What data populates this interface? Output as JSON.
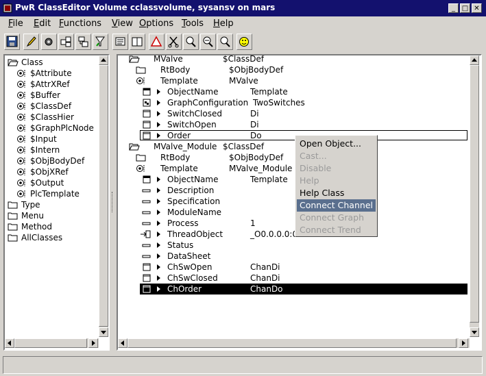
{
  "window": {
    "title": "PwR ClassEditor Volume cclassvolume, sysansv on mars"
  },
  "menubar": [
    {
      "u": "F",
      "rest": "ile"
    },
    {
      "u": "E",
      "rest": "dit"
    },
    {
      "u": "F",
      "rest": "unctions"
    },
    {
      "u": "V",
      "rest": "iew"
    },
    {
      "u": "O",
      "rest": "ptions"
    },
    {
      "u": "T",
      "rest": "ools"
    },
    {
      "u": "H",
      "rest": "elp"
    }
  ],
  "toolbar": [
    "save-icon",
    "edit-icon",
    "gear-icon",
    "objects-icon",
    "hierarchy-icon",
    "filter-icon",
    "view-icon",
    "book-icon",
    "warning-icon",
    "cut-icon",
    "zoom-in-icon",
    "zoom-out-icon",
    "smiley-icon"
  ],
  "left_tree": [
    {
      "label": "Class",
      "indent": 0,
      "icon": "folder-open"
    },
    {
      "label": "$Attribute",
      "indent": 1,
      "icon": "gear"
    },
    {
      "label": "$AttrXRef",
      "indent": 1,
      "icon": "gear"
    },
    {
      "label": "$Buffer",
      "indent": 1,
      "icon": "gear"
    },
    {
      "label": "$ClassDef",
      "indent": 1,
      "icon": "gear"
    },
    {
      "label": "$ClassHier",
      "indent": 1,
      "icon": "gear"
    },
    {
      "label": "$GraphPlcNode",
      "indent": 1,
      "icon": "gear"
    },
    {
      "label": "$Input",
      "indent": 1,
      "icon": "gear"
    },
    {
      "label": "$Intern",
      "indent": 1,
      "icon": "gear"
    },
    {
      "label": "$ObjBodyDef",
      "indent": 1,
      "icon": "gear"
    },
    {
      "label": "$ObjXRef",
      "indent": 1,
      "icon": "gear"
    },
    {
      "label": "$Output",
      "indent": 1,
      "icon": "gear"
    },
    {
      "label": "PlcTemplate",
      "indent": 1,
      "icon": "gear"
    },
    {
      "label": "Type",
      "indent": 0,
      "icon": "folder"
    },
    {
      "label": "Menu",
      "indent": 0,
      "icon": "folder"
    },
    {
      "label": "Method",
      "indent": 0,
      "icon": "folder"
    },
    {
      "label": "AllClasses",
      "indent": 0,
      "icon": "folder"
    }
  ],
  "right_tree": [
    {
      "name": "MValve",
      "cls": "$ClassDef",
      "level": 0,
      "icon": "folder-open"
    },
    {
      "name": "RtBody",
      "cls": "$ObjBodyDef",
      "level": 1,
      "icon": "folder"
    },
    {
      "name": "Template",
      "cls": "MValve",
      "level": 1,
      "icon": "gear"
    },
    {
      "name": "ObjectName",
      "cls": "Template",
      "level": 2,
      "icon": "attr"
    },
    {
      "name": "GraphConfiguration",
      "cls": "TwoSwitches",
      "level": 2,
      "icon": "graph"
    },
    {
      "name": "SwitchClosed",
      "cls": "Di",
      "level": 2,
      "icon": "box"
    },
    {
      "name": "SwitchOpen",
      "cls": "Di",
      "level": 2,
      "icon": "box"
    },
    {
      "name": "Order",
      "cls": "Do",
      "level": 2,
      "icon": "box",
      "framed": true
    },
    {
      "name": "MValve_Module",
      "cls": "$ClassDef",
      "level": 0,
      "icon": "folder-open"
    },
    {
      "name": "RtBody",
      "cls": "$ObjBodyDef",
      "level": 1,
      "icon": "folder"
    },
    {
      "name": "Template",
      "cls": "MValve_Module",
      "level": 1,
      "icon": "gear"
    },
    {
      "name": "ObjectName",
      "cls": "Template",
      "level": 2,
      "icon": "attr"
    },
    {
      "name": "Description",
      "cls": "",
      "level": 2,
      "icon": "dash"
    },
    {
      "name": "Specification",
      "cls": "",
      "level": 2,
      "icon": "dash"
    },
    {
      "name": "ModuleName",
      "cls": "",
      "level": 2,
      "icon": "dash"
    },
    {
      "name": "Process",
      "cls": "1",
      "level": 2,
      "icon": "dash"
    },
    {
      "name": "ThreadObject",
      "cls": "_O0.0.0.0:0",
      "level": 2,
      "icon": "arrow"
    },
    {
      "name": "Status",
      "cls": "",
      "level": 2,
      "icon": "dash"
    },
    {
      "name": "DataSheet",
      "cls": "",
      "level": 2,
      "icon": "dash"
    },
    {
      "name": "ChSwOpen",
      "cls": "ChanDi",
      "level": 2,
      "icon": "box"
    },
    {
      "name": "ChSwClosed",
      "cls": "ChanDi",
      "level": 2,
      "icon": "box"
    },
    {
      "name": "ChOrder",
      "cls": "ChanDo",
      "level": 2,
      "icon": "box",
      "selected": true
    }
  ],
  "context_menu": [
    {
      "label": "Open Object...",
      "state": "enabled"
    },
    {
      "label": "Cast...",
      "state": "disabled"
    },
    {
      "label": "Disable",
      "state": "disabled"
    },
    {
      "label": "Help",
      "state": "disabled"
    },
    {
      "label": "Help Class",
      "state": "enabled"
    },
    {
      "label": "Connect Channel",
      "state": "highlighted"
    },
    {
      "label": "Connect Graph",
      "state": "disabled"
    },
    {
      "label": "Connect Trend",
      "state": "disabled"
    }
  ]
}
